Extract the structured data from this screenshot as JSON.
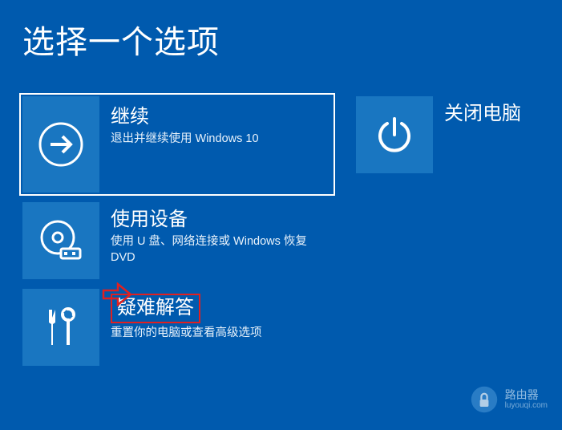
{
  "title": "选择一个选项",
  "options": {
    "continue": {
      "title": "继续",
      "desc": "退出并继续使用 Windows 10"
    },
    "use_device": {
      "title": "使用设备",
      "desc": "使用 U 盘、网络连接或 Windows 恢复 DVD"
    },
    "troubleshoot": {
      "title": "疑难解答",
      "desc": "重置你的电脑或查看高级选项"
    },
    "shutdown": {
      "title": "关闭电脑"
    }
  },
  "watermark": {
    "name": "路由器",
    "url": "luyouqi.com"
  }
}
